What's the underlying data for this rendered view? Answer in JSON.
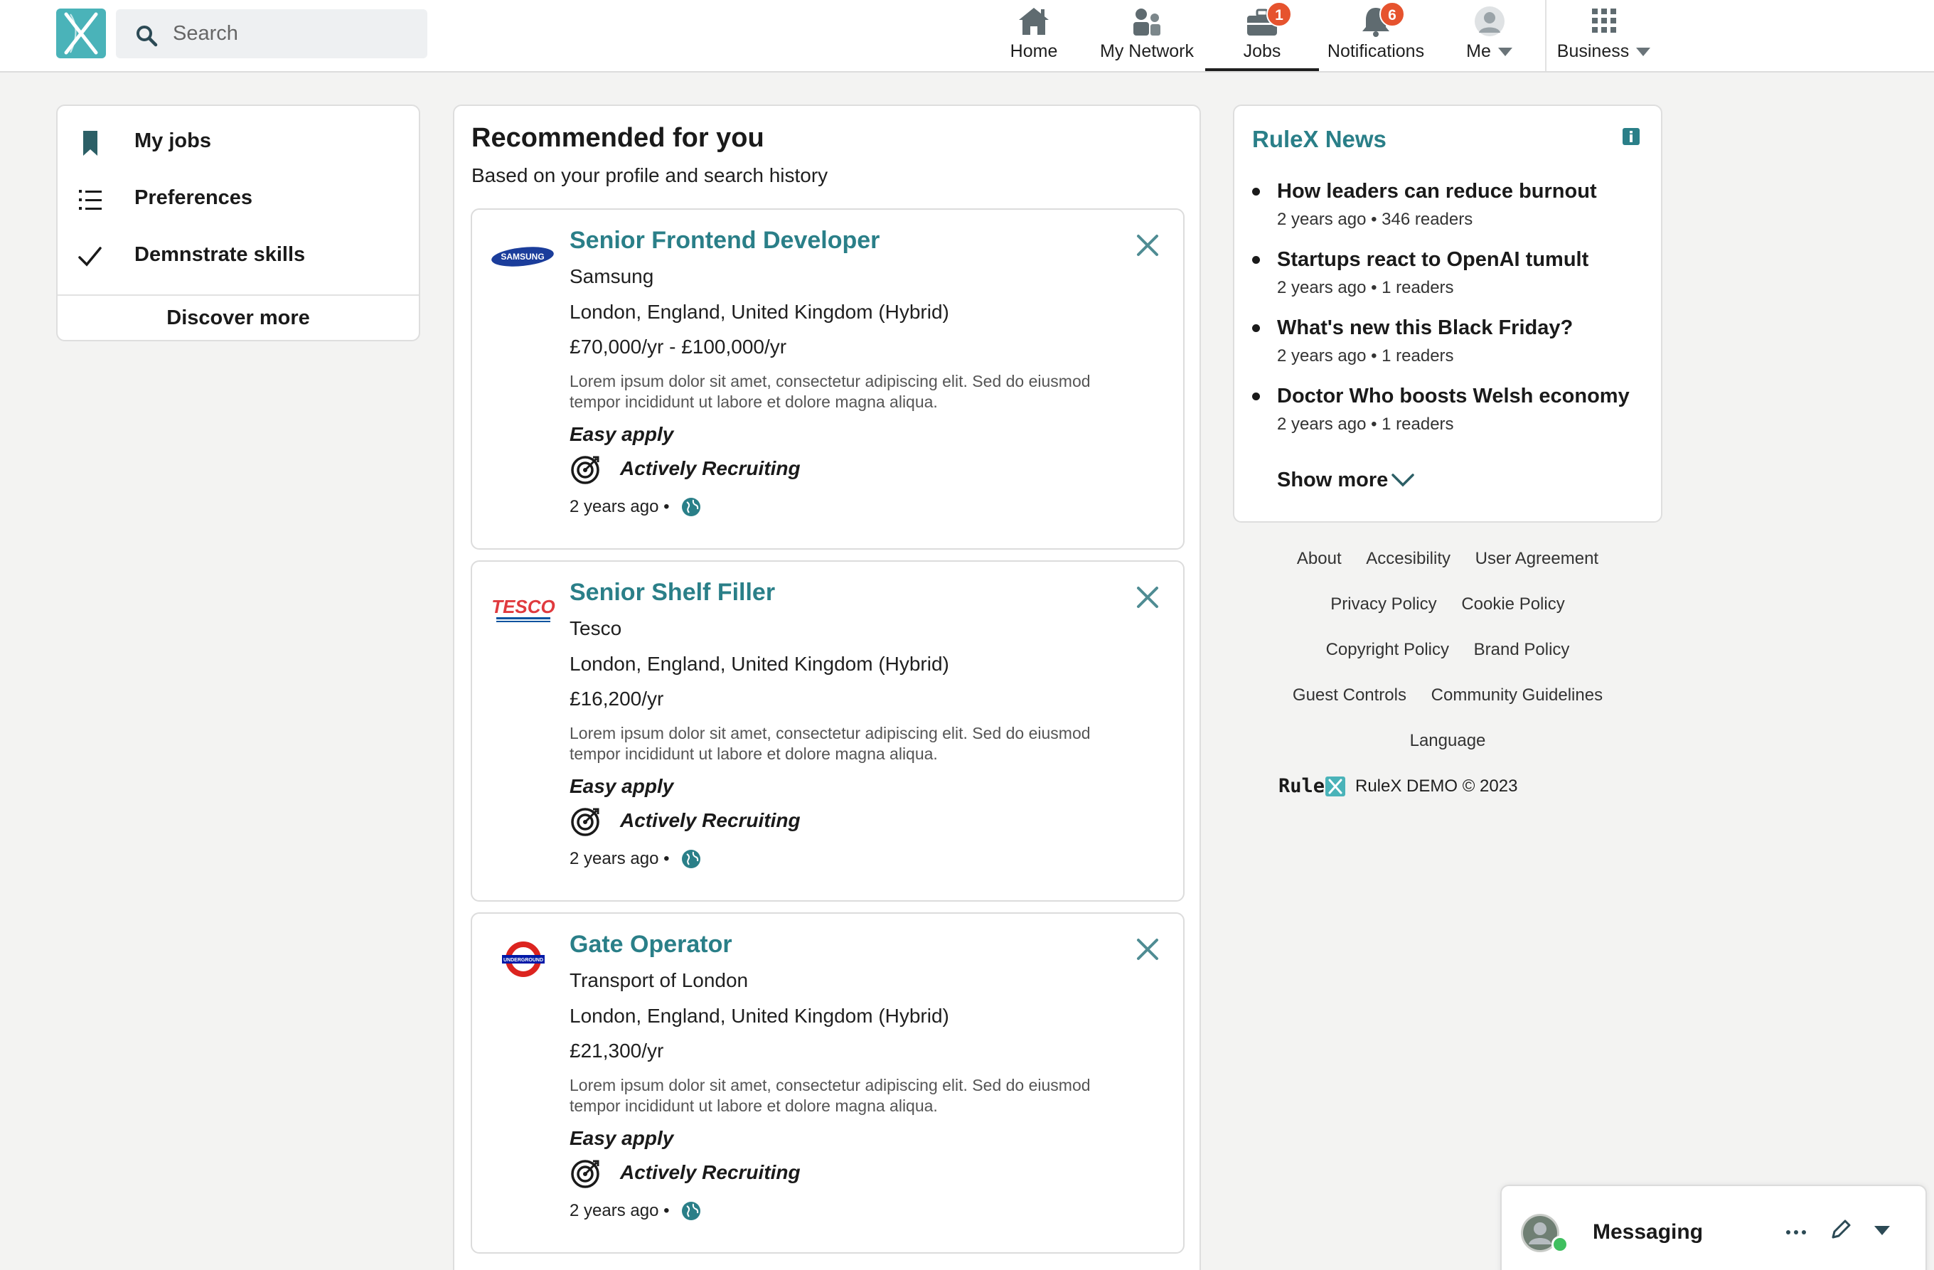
{
  "search": {
    "placeholder": "Search"
  },
  "nav": {
    "home": "Home",
    "network": "My Network",
    "jobs": "Jobs",
    "jobs_badge": "1",
    "notifications": "Notifications",
    "notifications_badge": "6",
    "me": "Me",
    "business": "Business"
  },
  "sidebar": {
    "items": [
      {
        "label": "My jobs",
        "icon": "bookmark-icon"
      },
      {
        "label": "Preferences",
        "icon": "list-icon"
      },
      {
        "label": "Demnstrate skills",
        "icon": "check-icon"
      }
    ],
    "discover": "Discover more"
  },
  "recommended": {
    "title": "Recommended for you",
    "subtitle": "Based on your profile and search history",
    "jobs": [
      {
        "title": "Senior Frontend Developer",
        "company": "Samsung",
        "logo_text": "SAMSUNG",
        "location": "London, England, United Kingdom (Hybrid)",
        "salary": "£70,000/yr - £100,000/yr",
        "description": "Lorem ipsum dolor sit amet, consectetur adipiscing elit. Sed do eiusmod tempor incididunt ut labore et dolore magna aliqua.",
        "easy_apply": "Easy apply",
        "recruiting": "Actively Recruiting",
        "posted": "2 years ago •"
      },
      {
        "title": "Senior Shelf Filler",
        "company": "Tesco",
        "logo_text": "TESCO",
        "location": "London, England, United Kingdom (Hybrid)",
        "salary": "£16,200/yr",
        "description": "Lorem ipsum dolor sit amet, consectetur adipiscing elit. Sed do eiusmod tempor incididunt ut labore et dolore magna aliqua.",
        "easy_apply": "Easy apply",
        "recruiting": "Actively Recruiting",
        "posted": "2 years ago •"
      },
      {
        "title": "Gate Operator",
        "company": "Transport of London",
        "logo_text": "UNDERGROUND",
        "location": "London, England, United Kingdom (Hybrid)",
        "salary": "£21,300/yr",
        "description": "Lorem ipsum dolor sit amet, consectetur adipiscing elit. Sed do eiusmod tempor incididunt ut labore et dolore magna aliqua.",
        "easy_apply": "Easy apply",
        "recruiting": "Actively Recruiting",
        "posted": "2 years ago •"
      }
    ]
  },
  "news": {
    "title": "RuleX News",
    "items": [
      {
        "headline": "How leaders can reduce burnout",
        "meta": "2 years ago • 346 readers"
      },
      {
        "headline": "Startups react to OpenAI tumult",
        "meta": "2 years ago • 1 readers"
      },
      {
        "headline": "What's new this Black Friday?",
        "meta": "2 years ago • 1 readers"
      },
      {
        "headline": "Doctor Who boosts Welsh economy",
        "meta": "2 years ago • 1 readers"
      }
    ],
    "show_more": "Show more"
  },
  "footer": {
    "about": "About",
    "accessibility": "Accesibility",
    "user_agreement": "User Agreement",
    "privacy": "Privacy Policy",
    "cookie": "Cookie Policy",
    "copyright": "Copyright Policy",
    "brand": "Brand Policy",
    "guest": "Guest Controls",
    "community": "Community Guidelines",
    "language": "Language",
    "brand_word": "Rule",
    "copy": "RuleX DEMO © 2023"
  },
  "messaging": {
    "label": "Messaging"
  },
  "colors": {
    "accent": "#2a7f88",
    "logo": "#4ab3b9",
    "badge": "#e6532e",
    "online": "#3fbf5f"
  }
}
